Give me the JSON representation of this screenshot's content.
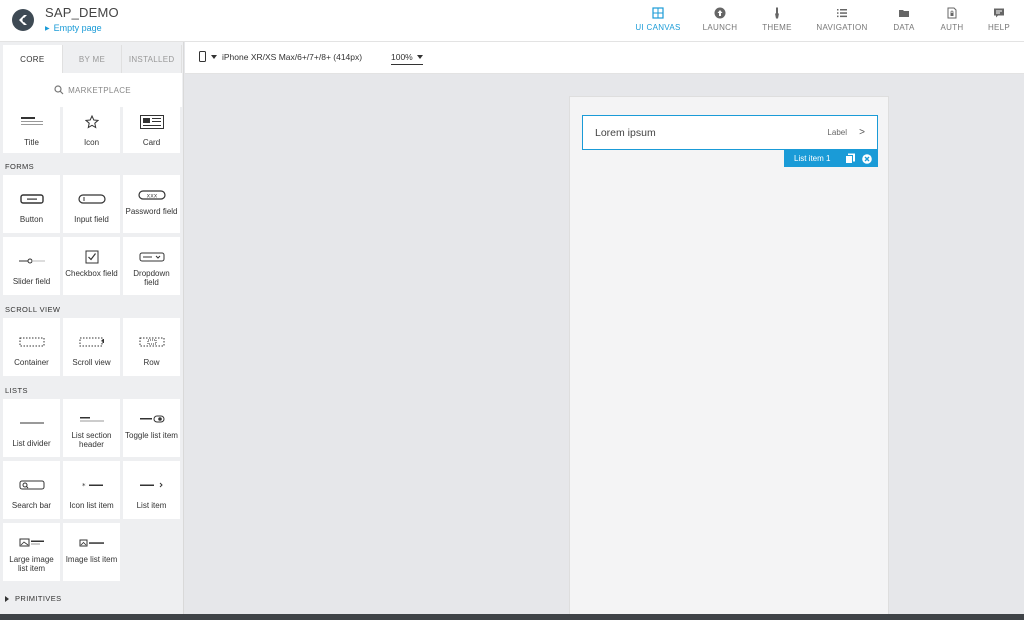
{
  "app": {
    "title": "SAP_DEMO",
    "page": "Empty page"
  },
  "nav": [
    {
      "label": "UI CANVAS",
      "icon": "grid-icon",
      "active": true
    },
    {
      "label": "LAUNCH",
      "icon": "upload-icon",
      "active": false
    },
    {
      "label": "THEME",
      "icon": "brush-icon",
      "active": false
    },
    {
      "label": "NAVIGATION",
      "icon": "list-icon",
      "active": false
    },
    {
      "label": "DATA",
      "icon": "folder-icon",
      "active": false
    },
    {
      "label": "AUTH",
      "icon": "document-lock-icon",
      "active": false
    },
    {
      "label": "HELP",
      "icon": "chat-icon",
      "active": false
    }
  ],
  "sidebar": {
    "tabs": [
      "CORE",
      "BY ME",
      "INSTALLED"
    ],
    "marketplace": "MARKETPLACE",
    "sections": {
      "forms": "FORMS",
      "scroll_view": "SCROLL VIEW",
      "lists": "LISTS",
      "primitives": "PRIMITIVES"
    },
    "top_tiles": [
      "Title",
      "Icon",
      "Card"
    ],
    "forms": [
      "Button",
      "Input field",
      "Password field",
      "Slider field",
      "Checkbox field",
      "Dropdown field"
    ],
    "scroll_view": [
      "Container",
      "Scroll view",
      "Row"
    ],
    "lists": [
      "List divider",
      "List section header",
      "Toggle list item",
      "Search bar",
      "Icon list item",
      "List item",
      "Large image list item",
      "Image list item"
    ]
  },
  "toolbar": {
    "device": "iPhone XR/XS Max/6+/7+/8+ (414px)",
    "zoom": "100%"
  },
  "canvas": {
    "list_item": {
      "title": "Lorem ipsum",
      "label": "Label",
      "chevron": ">"
    },
    "selection_tag": "List item 1"
  },
  "colors": {
    "accent": "#1a9bd7",
    "sidebar_bg": "#eeeff1",
    "canvas_bg": "#e6e7ea"
  }
}
